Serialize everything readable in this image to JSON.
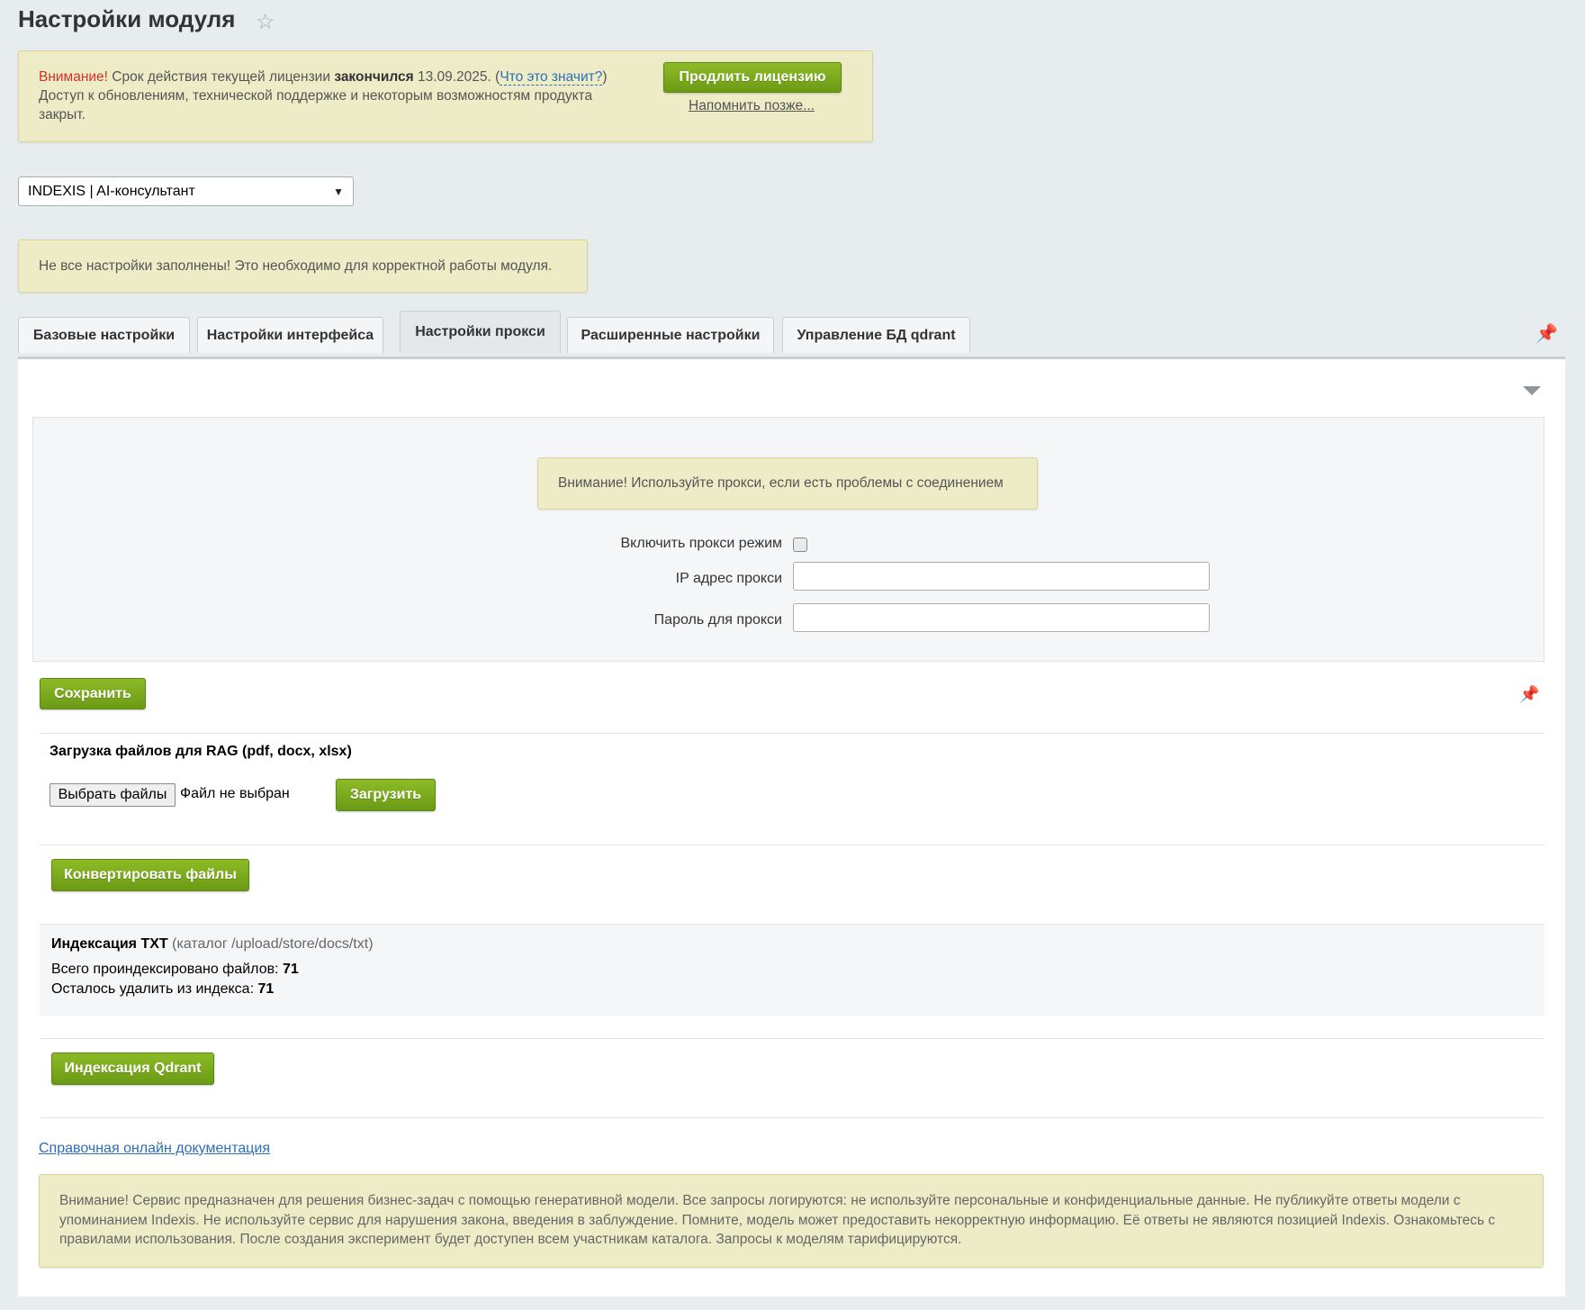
{
  "page": {
    "title": "Настройки модуля"
  },
  "license": {
    "warning_word": "Внимание!",
    "text_part1": " Срок действия текущей лицензии ",
    "expired_word": "закончился",
    "date_text": " 13.09.2025. (",
    "what_means_link": "Что это значит?",
    "close_paren": ")",
    "text_line2": "Доступ к обновлениям, технической поддержке и некоторым возможностям продукта закрыт.",
    "renew_button": "Продлить лицензию",
    "remind_link": "Напомнить позже..."
  },
  "module_select": {
    "selected": "INDEXIS | AI-консультант"
  },
  "settings_notice": {
    "text": "Не все настройки заполнены! Это необходимо для корректной работы модуля."
  },
  "tabs": [
    {
      "label": "Базовые настройки",
      "active": false
    },
    {
      "label": "Настройки интерфейса",
      "active": false
    },
    {
      "label": "Настройки прокси",
      "active": true
    },
    {
      "label": "Расширенные настройки",
      "active": false
    },
    {
      "label": "Управление БД qdrant",
      "active": false
    }
  ],
  "proxy": {
    "notice": "Внимание! Используйте прокси, если есть проблемы с соединением",
    "enable_label": "Включить прокси режим",
    "enable_checked": false,
    "ip_label": "IP адрес прокси",
    "ip_value": "",
    "password_label": "Пароль для прокси",
    "password_value": ""
  },
  "save_button": "Сохранить",
  "upload": {
    "title": "Загрузка файлов для RAG (pdf, docx, xlsx)",
    "choose_button": "Выбрать файлы",
    "file_status": "Файл не выбран",
    "upload_button": "Загрузить"
  },
  "convert_button": "Конвертировать файлы",
  "indexing": {
    "title": "Индексация TXT",
    "catalog": " (каталог /upload/store/docs/txt)",
    "total_label": "Всего проиндексировано файлов: ",
    "total_value": "71",
    "remaining_label": "Осталось удалить из индекса: ",
    "remaining_value": "71"
  },
  "qdrant_button": "Индексация Qdrant",
  "docs_link": "Справочная онлайн документация",
  "disclaimer": "Внимание! Сервис предназначен для решения бизнес-задач с помощью генеративной модели. Все запросы логируются: не используйте персональные и конфиденциальные данные. Не публикуйте ответы модели с упоминанием Indexis. Не используйте сервис для нарушения закона, введения в заблуждение. Помните, модель может предоставить некорректную информацию. Её ответы не являются позицией Indexis. Ознакомьтесь с правилами использования. После создания эксперимент будет доступен всем участникам каталога. Запросы к моделям тарифицируются.",
  "colors": {
    "accent_green": "#7aaa1d",
    "notice_bg": "#eeecc7",
    "warning_red": "#d23228",
    "link_blue": "#2f6db5"
  },
  "icons": [
    "star-icon",
    "chevron-down-icon",
    "pin-icon",
    "collapse-arrow-icon"
  ]
}
